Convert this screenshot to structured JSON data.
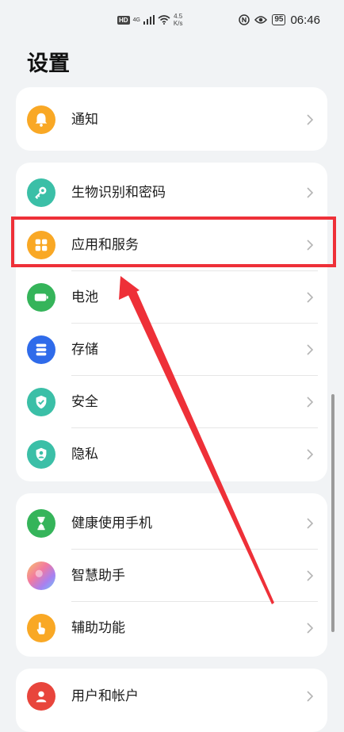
{
  "status_bar": {
    "hd": "HD",
    "network": "4G",
    "speed_value": "4.5",
    "speed_unit": "K/s",
    "battery": "95",
    "time": "06:46"
  },
  "page": {
    "title": "设置"
  },
  "groups": [
    {
      "items": [
        {
          "label": "通知",
          "icon": "bell-icon",
          "color": "#f9a825"
        }
      ]
    },
    {
      "items": [
        {
          "label": "生物识别和密码",
          "icon": "key-icon",
          "color": "#3bbfa7"
        },
        {
          "label": "应用和服务",
          "icon": "apps-grid-icon",
          "color": "#f9a825",
          "highlighted": true
        },
        {
          "label": "电池",
          "icon": "battery-icon",
          "color": "#35b45a"
        },
        {
          "label": "存储",
          "icon": "storage-icon",
          "color": "#2f6bea"
        },
        {
          "label": "安全",
          "icon": "shield-check-icon",
          "color": "#3bbfa7"
        },
        {
          "label": "隐私",
          "icon": "privacy-shield-icon",
          "color": "#3bbfa7"
        }
      ]
    },
    {
      "items": [
        {
          "label": "健康使用手机",
          "icon": "hourglass-icon",
          "color": "#35b45a"
        },
        {
          "label": "智慧助手",
          "icon": "assistant-orb-icon",
          "color": "#b07ee6"
        },
        {
          "label": "辅助功能",
          "icon": "hand-tap-icon",
          "color": "#f9a825"
        }
      ]
    },
    {
      "items": [
        {
          "label": "用户和帐户",
          "icon": "user-icon",
          "color": "#e8453c"
        }
      ]
    }
  ],
  "annotation": {
    "highlight_color": "#ee3038"
  }
}
